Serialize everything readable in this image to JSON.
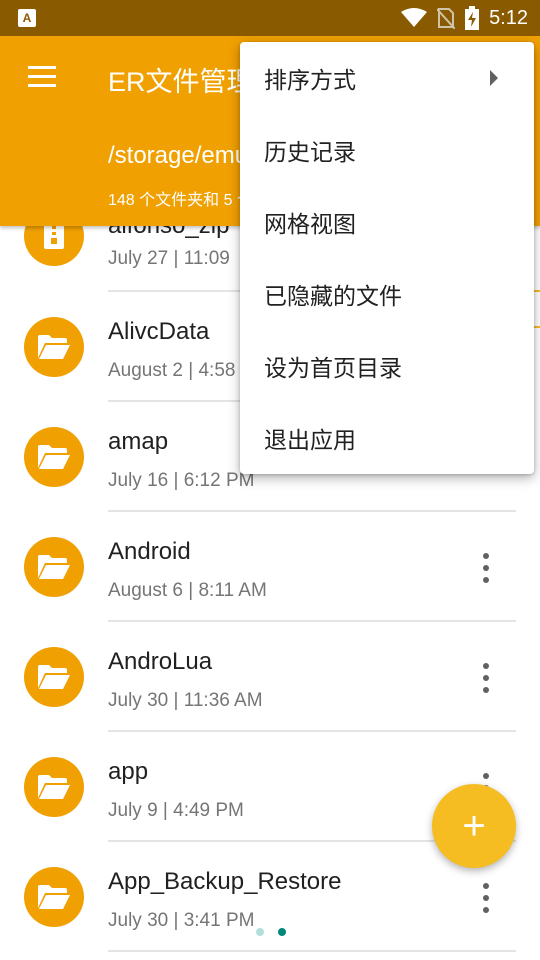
{
  "status_bar": {
    "time": "5:12",
    "left_icon": "A"
  },
  "app_bar": {
    "title": "ER文件管理器",
    "path": "/storage/emulated/0",
    "summary": "148 个文件夹和 5 个文件"
  },
  "files": [
    {
      "name": "alfonso_zip",
      "date": "July 27 | 11:09",
      "icon": "zip-icon"
    },
    {
      "name": "AlivcData",
      "date": "August 2 | 4:58 PM",
      "icon": "folder-icon"
    },
    {
      "name": "amap",
      "date": "July 16 | 6:12 PM",
      "icon": "folder-icon"
    },
    {
      "name": "Android",
      "date": "August 6 | 8:11 AM",
      "icon": "folder-icon"
    },
    {
      "name": "AndroLua",
      "date": "July 30 | 11:36 AM",
      "icon": "folder-icon"
    },
    {
      "name": "app",
      "date": "July 9 | 4:49 PM",
      "icon": "folder-icon"
    },
    {
      "name": "App_Backup_Restore",
      "date": "July 30 | 3:41 PM",
      "icon": "folder-icon"
    }
  ],
  "menu": {
    "items": [
      {
        "label": "排序方式"
      },
      {
        "label": "历史记录"
      },
      {
        "label": "网格视图"
      },
      {
        "label": "已隐藏的文件"
      },
      {
        "label": "设为首页目录"
      },
      {
        "label": "退出应用"
      }
    ]
  },
  "fab": {
    "label": "+"
  },
  "colors": {
    "primary": "#f0a000",
    "status_bar": "#8a5a00",
    "fab": "#f5bd21",
    "page_dot_inactive": "#b2dfdb",
    "page_dot_active": "#00897b"
  }
}
